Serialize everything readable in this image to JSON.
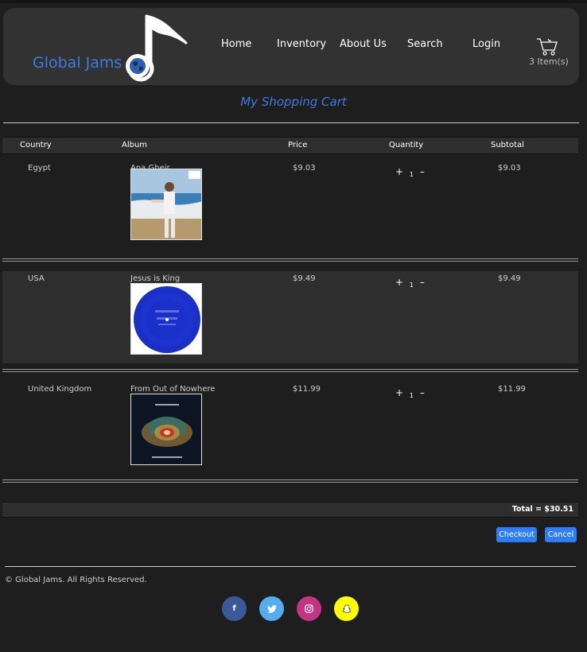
{
  "header": {
    "logo_text": "Global Jams",
    "nav": [
      "Home",
      "Inventory",
      "About Us",
      "Search",
      "Login"
    ],
    "cart_count": "3 Item(s)"
  },
  "cart": {
    "title": "My Shopping Cart",
    "columns": [
      "Country",
      "Album",
      "Price",
      "Quantity",
      "Subtotal"
    ],
    "items": [
      {
        "country": "Egypt",
        "album": "Ana Gheir",
        "price": "$9.03",
        "quantity": "1",
        "subtotal": "$9.03",
        "art": "cover-ana-gheir"
      },
      {
        "country": "USA",
        "album": "Jesus is King",
        "price": "$9.49",
        "quantity": "1",
        "subtotal": "$9.49",
        "art": "cover-jesus-is-king"
      },
      {
        "country": "United Kingdom",
        "album": "From Out of Nowhere",
        "price": "$11.99",
        "quantity": "1",
        "subtotal": "$11.99",
        "art": "cover-from-out-of-nowhere"
      }
    ],
    "qty_plus": "+",
    "qty_minus": "–",
    "total": "Total = $30.51"
  },
  "buttons": {
    "checkout": "Checkout",
    "cancel": "Cancel"
  },
  "footer": {
    "copyright": "© Global Jams. All Rights Reserved.",
    "social": [
      {
        "name": "facebook-icon",
        "glyph": "f",
        "color": "#3b5998"
      },
      {
        "name": "twitter-icon",
        "glyph": "🐦",
        "color": "#55acee"
      },
      {
        "name": "instagram-icon",
        "glyph": "◎",
        "color": "#c13584"
      },
      {
        "name": "snapchat-icon",
        "glyph": "👻",
        "color": "#fffc00"
      }
    ]
  },
  "colors": {
    "accent": "#3d7be0",
    "button": "#2f7df5",
    "background": "#1f1f1f",
    "panel": "#323232"
  }
}
